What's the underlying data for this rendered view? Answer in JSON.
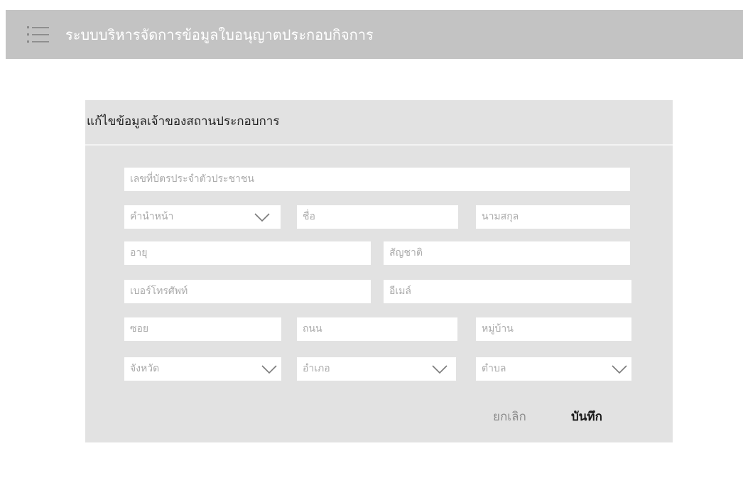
{
  "header": {
    "title": "ระบบบริหารจัดการข้อมูลใบอนุญาตประกอบกิจการ",
    "menu_icon": "hamburger-list-icon"
  },
  "form": {
    "title": "แก้ไขข้อมูลเจ้าของสถานประกอบการ",
    "fields": {
      "id_card": "เลขที่บัตรประจำตัวประชาชน",
      "prefix": "คำนำหน้า",
      "first_name": "ชื่อ",
      "last_name": "นามสกุล",
      "age": "อายุ",
      "nationality": "สัญชาติ",
      "phone": "เบอร์โทรศัพท์",
      "email": "อีเมล์",
      "soi": "ซอย",
      "road": "ถนน",
      "village": "หมู่บ้าน",
      "province": "จังหวัด",
      "district": "อำเภอ",
      "subdistrict": "ตำบล"
    },
    "buttons": {
      "cancel": "ยกเลิก",
      "save": "บันทึก"
    }
  },
  "colors": {
    "header_bg": "#c3c3c3",
    "card_bg": "#e2e2e2",
    "placeholder": "#aaaaaa",
    "icon": "#7a7a7a"
  }
}
